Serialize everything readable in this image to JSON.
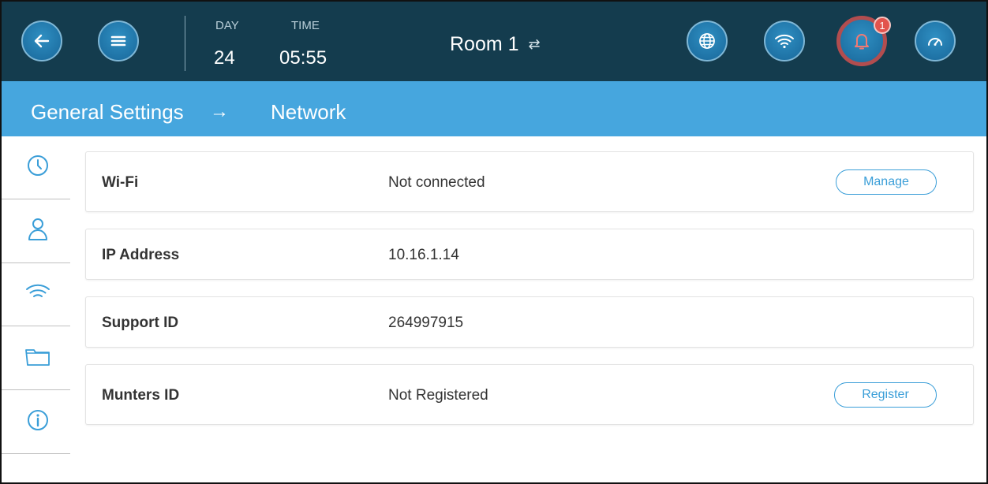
{
  "header": {
    "day_label": "DAY",
    "day_value": "24",
    "time_label": "TIME",
    "time_value": "05:55",
    "room_name": "Room 1",
    "room_swap_icon": "swap-arrows-icon",
    "alarm_count": "1",
    "buttons": {
      "back": "arrow-left-icon",
      "menu": "hamburger-menu-icon",
      "globe": "globe-icon",
      "wifi": "wifi-icon",
      "alarm": "bell-icon",
      "gauge": "gauge-icon"
    }
  },
  "breadcrumb": {
    "parent": "General Settings",
    "separator": "→",
    "current": "Network"
  },
  "sidebar": {
    "items": [
      {
        "icon": "clock-icon"
      },
      {
        "icon": "user-icon"
      },
      {
        "icon": "wifi-icon"
      },
      {
        "icon": "folder-icon"
      },
      {
        "icon": "info-icon"
      }
    ]
  },
  "network": {
    "rows": [
      {
        "label": "Wi-Fi",
        "value": "Not connected",
        "action": "Manage"
      },
      {
        "label": "IP Address",
        "value": "10.16.1.14"
      },
      {
        "label": "Support ID",
        "value": "264997915"
      },
      {
        "label": "Munters ID",
        "value": "Not Registered",
        "action": "Register"
      }
    ]
  },
  "colors": {
    "topbar": "#143c4e",
    "breadcrumb_bar": "#46a6de",
    "accent": "#3a9ed8",
    "alarm_ring": "#b24d4f",
    "badge": "#e2534d"
  }
}
